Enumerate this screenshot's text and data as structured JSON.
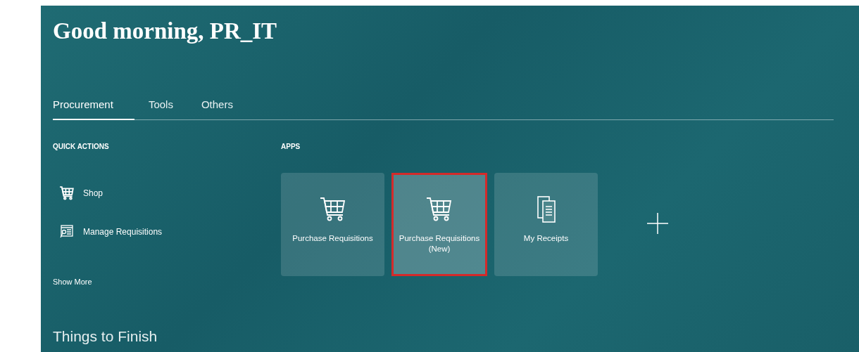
{
  "greeting": "Good morning, PR_IT",
  "tabs": [
    {
      "label": "Procurement",
      "selected": true
    },
    {
      "label": "Tools",
      "selected": false
    },
    {
      "label": "Others",
      "selected": false
    }
  ],
  "quick_actions": {
    "heading": "QUICK ACTIONS",
    "items": [
      {
        "label": "Shop",
        "kind": "shopping"
      },
      {
        "label": "Manage Requisitions",
        "kind": "managing"
      }
    ],
    "show_more": "Show More"
  },
  "apps": {
    "heading": "APPS",
    "tiles": [
      {
        "label": "Purchase Requisitions",
        "kind": "shopping",
        "highlighted": false
      },
      {
        "label": "Purchase Requisitions (New)",
        "kind": "shopping",
        "highlighted": true
      },
      {
        "label": "My Receipts",
        "kind": "receiving",
        "highlighted": false
      },
      {
        "kind": "add",
        "highlighted": false
      }
    ]
  },
  "things_to_finish": {
    "heading": "Things to Finish"
  }
}
